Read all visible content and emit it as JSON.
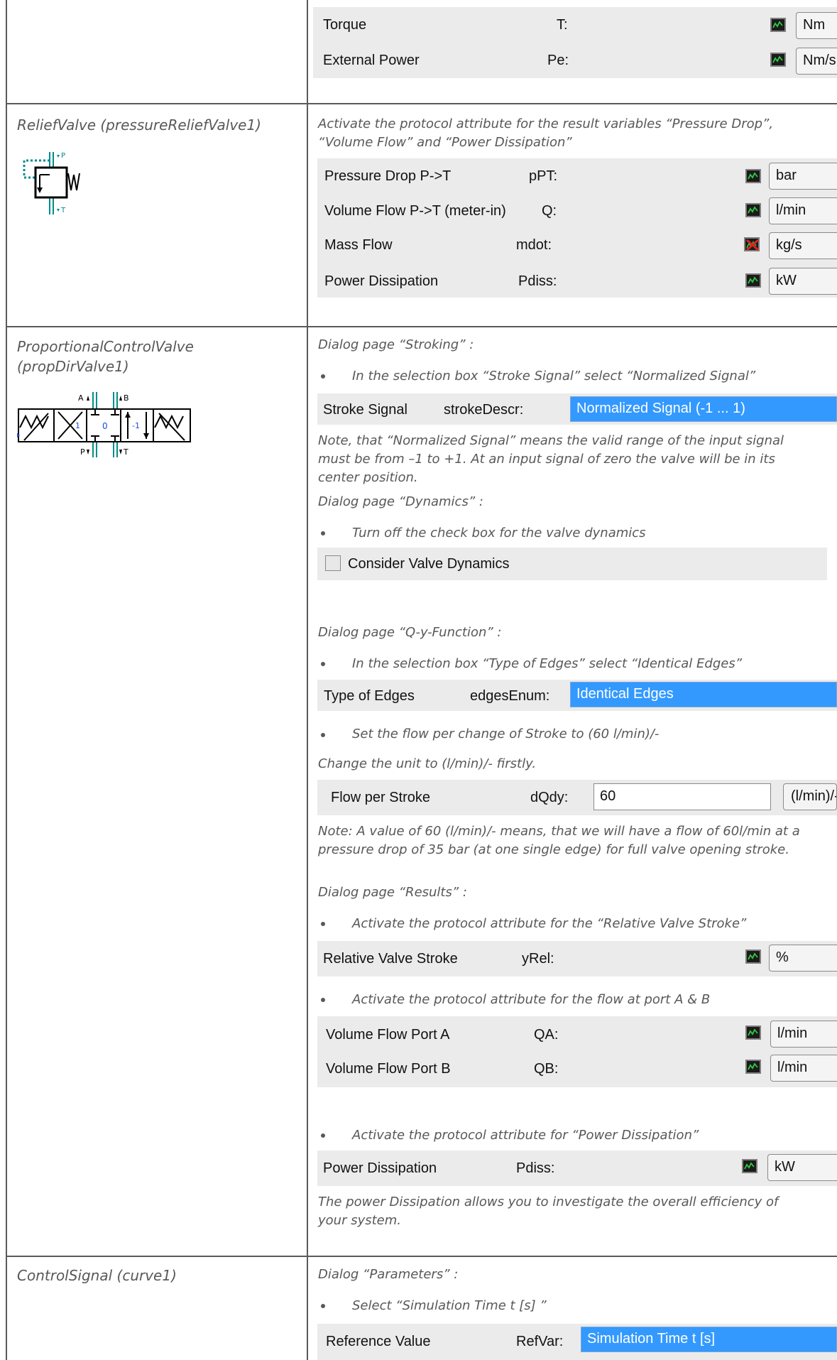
{
  "top": {
    "torque": {
      "label": "Torque",
      "var": "T:",
      "unit": "Nm"
    },
    "ext_power": {
      "label": "External Power",
      "var": "Pe:",
      "unit": "Nm/s"
    }
  },
  "relief": {
    "name": "ReliefValve (pressureReliefValve1)",
    "symbol": {
      "p": "P",
      "t": "T"
    },
    "instruction": "Activate the protocol attribute for the result variables “Pressure Drop”, “Volume Flow” and “Power Dissipation”",
    "rows": [
      {
        "label": "Pressure Drop P->T",
        "var": "pPT:",
        "unit": "bar"
      },
      {
        "label": "Volume Flow P->T (meter-in)",
        "var": "Q:",
        "unit": "l/min"
      },
      {
        "label": "Mass Flow",
        "var": "mdot:",
        "unit": "kg/s"
      },
      {
        "label": "Power Dissipation",
        "var": "Pdiss:",
        "unit": "kW"
      }
    ]
  },
  "prop": {
    "name_line1": "ProportionalControlValve",
    "name_line2": "(propDirValve1)",
    "symbol": {
      "a": "A",
      "b": "B",
      "p": "P",
      "t": "T",
      "pos_left": "1",
      "pos_center": "0",
      "pos_right": "-1"
    },
    "stroking_title": "Dialog page “Stroking” :",
    "stroking_bullet": "In the selection box “Stroke Signal” select “Normalized Signal”",
    "stroke_signal": {
      "label": "Stroke Signal",
      "var": "strokeDescr:",
      "value": "Normalized Signal (-1 ... 1)"
    },
    "stroke_note": "Note, that “Normalized Signal” means the valid range of the input signal must be from –1 to +1. At an input signal of zero the valve will be in its center position.",
    "dynamics_title": "Dialog page “Dynamics” :",
    "dynamics_bullet": "Turn off the check box for the valve dynamics",
    "dynamics_checkbox": "Consider Valve Dynamics",
    "qy_title": "Dialog page “Q-y-Function” :",
    "qy_bullet": "In the selection box “Type of Edges” select “Identical Edges”",
    "edges": {
      "label": "Type of Edges",
      "var": "edgesEnum:",
      "value": "Identical Edges"
    },
    "flow_bullet": "Set the flow per change of Stroke to (60 l/min)/-",
    "flow_change": "Change the unit to (l/min)/- firstly.",
    "flow_per_stroke": {
      "label": "Flow per Stroke",
      "var": "dQdy:",
      "value": "60",
      "unit": "(l/min)/-"
    },
    "flow_note": "Note: A value of 60 (l/min)/- means, that we will have a flow of 60l/min at a pressure drop of 35 bar (at one single edge) for full valve opening stroke.",
    "results_title": "Dialog page “Results” :",
    "results_bullet1": "Activate the protocol attribute for the “Relative Valve Stroke”",
    "rel_stroke": {
      "label": "Relative Valve Stroke",
      "var": "yRel:",
      "unit": "%"
    },
    "results_bullet2": "Activate the protocol attribute for the flow at port A & B",
    "flow_ports": [
      {
        "label": "Volume Flow Port A",
        "var": "QA:",
        "unit": "l/min"
      },
      {
        "label": "Volume Flow Port B",
        "var": "QB:",
        "unit": "l/min"
      }
    ],
    "results_bullet3": "Activate the protocol attribute for “Power Dissipation”",
    "power": {
      "label": "Power Dissipation",
      "var": "Pdiss:",
      "unit": "kW"
    },
    "power_note": "The power Dissipation allows you to investigate the overall efficiency of your system."
  },
  "control": {
    "name": "ControlSignal (curve1)",
    "params_title": "Dialog “Parameters” :",
    "params_bullet": "Select “Simulation Time t [s] ”",
    "ref": {
      "label": "Reference Value",
      "var": "RefVar:",
      "value": "Simulation Time t [s]"
    }
  },
  "colors": {
    "border": "#5a5a5a",
    "panel": "#ebebeb",
    "italic_text": "#58585a",
    "selection": "#3399ff",
    "symbol_teal": "#008b8b"
  }
}
